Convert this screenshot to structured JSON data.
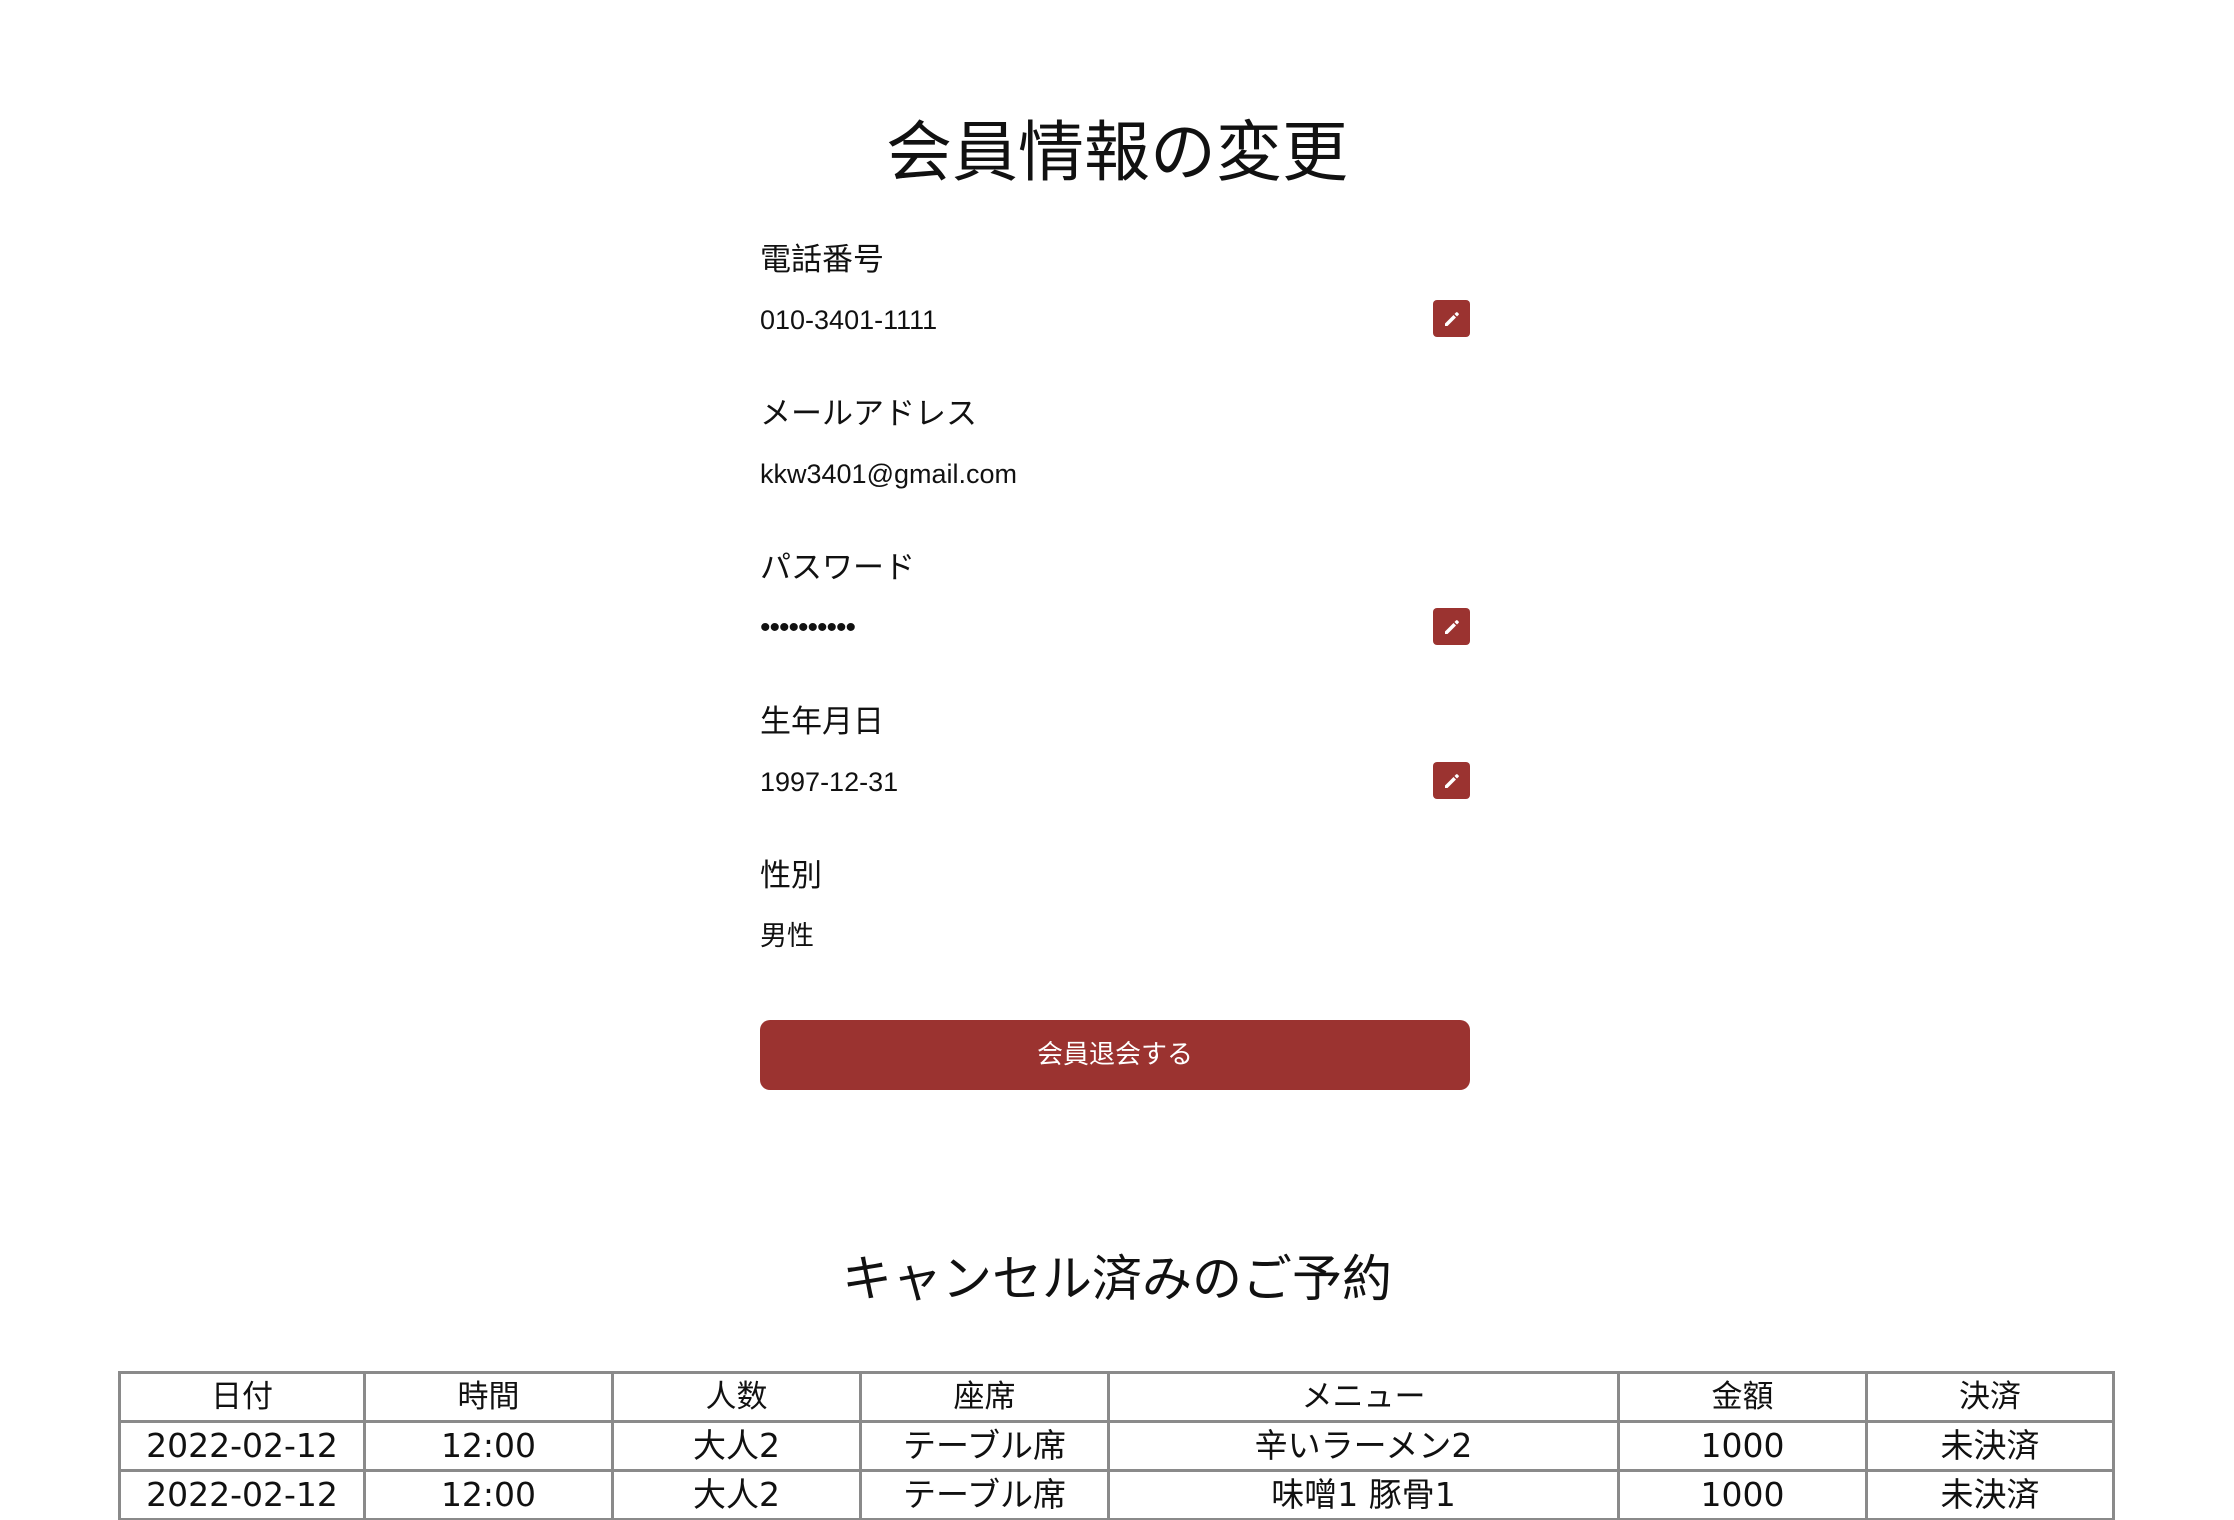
{
  "page_title": "会員情報の変更",
  "profile": {
    "fields": [
      {
        "label": "電話番号",
        "value": "010-3401-1111",
        "editable": true
      },
      {
        "label": "メールアドレス",
        "value": "kkw3401@gmail.com",
        "editable": false
      },
      {
        "label": "パスワード",
        "value": "••••••••••",
        "editable": true
      },
      {
        "label": "生年月日",
        "value": "1997-12-31",
        "editable": true
      },
      {
        "label": "性別",
        "value": "男性",
        "editable": false
      }
    ],
    "edit_icon": "pencil-icon",
    "withdraw_label": "会員退会する"
  },
  "cancelled": {
    "title": "キャンセル済みのご予約",
    "columns": [
      "日付",
      "時間",
      "人数",
      "座席",
      "メニュー",
      "金額",
      "決済"
    ],
    "rows": [
      [
        "2022-02-12",
        "12:00",
        "大人2",
        "テーブル席",
        "辛いラーメン2",
        "1000",
        "未決済"
      ],
      [
        "2022-02-12",
        "12:00",
        "大人2",
        "テーブル席",
        "味噌1 豚骨1",
        "1000",
        "未決済"
      ]
    ]
  },
  "colors": {
    "accent": "#9b3330",
    "table_border": "#8a8a8a",
    "text": "#111111",
    "background": "#ffffff"
  }
}
